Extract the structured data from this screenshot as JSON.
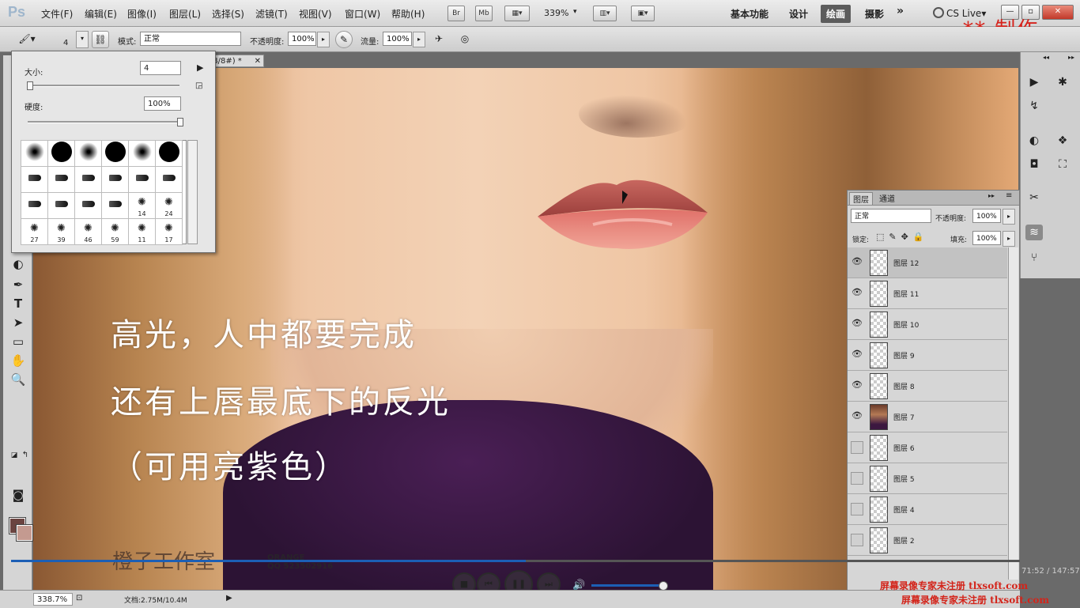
{
  "app": {
    "logo": "Ps"
  },
  "menu": {
    "items": [
      "文件(F)",
      "编辑(E)",
      "图像(I)",
      "图层(L)",
      "选择(S)",
      "滤镜(T)",
      "视图(V)",
      "窗口(W)",
      "帮助(H)"
    ]
  },
  "menubar_controls": {
    "bridge": "Br",
    "minibridge": "Mb",
    "zoom": "339%"
  },
  "workspaces": {
    "items": [
      "基本功能",
      "设计",
      "绘画",
      "摄影"
    ],
    "active": "绘画",
    "more": "»",
    "cs_live": "CS Live▾"
  },
  "window_controls": {
    "minimize": "—",
    "restore": "▫",
    "close": "✕"
  },
  "watermark_top": "** 制作",
  "options": {
    "brush_size": "4",
    "mode_label": "模式:",
    "mode_value": "正常",
    "opacity_label": "不透明度:",
    "opacity_value": "100%",
    "flow_label": "流量:",
    "flow_value": "100%"
  },
  "brush_popup": {
    "size_label": "大小:",
    "size_value": "4",
    "hardness_label": "硬度:",
    "hardness_value": "100%",
    "size_slider": 0.01,
    "hardness_slider": 1.0,
    "presets": [
      {
        "shape": "soft",
        "num": ""
      },
      {
        "shape": "hard",
        "num": ""
      },
      {
        "shape": "soft",
        "num": ""
      },
      {
        "shape": "hard",
        "num": ""
      },
      {
        "shape": "soft",
        "num": ""
      },
      {
        "shape": "hard",
        "num": ""
      },
      {
        "shape": "tip",
        "num": ""
      },
      {
        "shape": "tip",
        "num": ""
      },
      {
        "shape": "tip",
        "num": ""
      },
      {
        "shape": "tip",
        "num": ""
      },
      {
        "shape": "tip",
        "num": ""
      },
      {
        "shape": "tip",
        "num": ""
      },
      {
        "shape": "tip",
        "num": ""
      },
      {
        "shape": "tip",
        "num": ""
      },
      {
        "shape": "tip",
        "num": ""
      },
      {
        "shape": "tip",
        "num": ""
      },
      {
        "shape": "splat",
        "num": "14"
      },
      {
        "shape": "splat",
        "num": "24"
      },
      {
        "shape": "splat",
        "num": "27"
      },
      {
        "shape": "splat",
        "num": "39"
      },
      {
        "shape": "splat",
        "num": "46"
      },
      {
        "shape": "splat",
        "num": "59"
      },
      {
        "shape": "splat",
        "num": "11"
      },
      {
        "shape": "splat",
        "num": "17"
      }
    ]
  },
  "document": {
    "tab_title": "GB/8#) *",
    "tab_close": "✕"
  },
  "canvas_captions": [
    "高光，人中都要完成",
    "还有上唇最底下的反光",
    "（可用亮紫色）"
  ],
  "studio": {
    "name": "橙子工作室",
    "sub": "ORANGE\nQQ 523502916"
  },
  "layers_panel": {
    "tabs": [
      "图层",
      "通道"
    ],
    "blend_mode": "正常",
    "opacity_label": "不透明度:",
    "opacity_value": "100%",
    "lock_label": "锁定:",
    "fill_label": "填充:",
    "fill_value": "100%",
    "layers": [
      {
        "name": "图层 12",
        "visible": true,
        "selected": true,
        "photo": false
      },
      {
        "name": "图层 11",
        "visible": true,
        "selected": false,
        "photo": false
      },
      {
        "name": "图层 10",
        "visible": true,
        "selected": false,
        "photo": false
      },
      {
        "name": "图层 9",
        "visible": true,
        "selected": false,
        "photo": false
      },
      {
        "name": "图层 8",
        "visible": true,
        "selected": false,
        "photo": false
      },
      {
        "name": "图层 7",
        "visible": true,
        "selected": false,
        "photo": true
      },
      {
        "name": "图层 6",
        "visible": false,
        "selected": false,
        "photo": false
      },
      {
        "name": "图层 5",
        "visible": false,
        "selected": false,
        "photo": false
      },
      {
        "name": "图层 4",
        "visible": false,
        "selected": false,
        "photo": false
      },
      {
        "name": "图层 2",
        "visible": false,
        "selected": false,
        "photo": false
      }
    ]
  },
  "player": {
    "progress": 0.51,
    "volume": 0.95,
    "timecode": "71:52 / 147:57"
  },
  "status": {
    "zoom": "338.7%",
    "doc_size": "文档:2.75M/10.4M"
  },
  "red_notes": [
    "屏幕录像专家未注册 tlxsoft.com",
    "屏幕录像专家未注册 tlxsoft.com"
  ],
  "colors": {
    "foreground": "#6b4440",
    "background": "#c49a90",
    "accent": "#1c5fb5"
  }
}
